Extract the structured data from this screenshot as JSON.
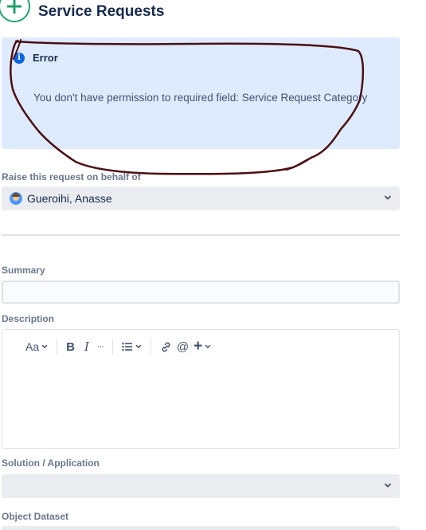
{
  "header": {
    "title": "Service Requests",
    "icon": "add-circle-icon"
  },
  "error": {
    "icon": "info-icon",
    "title": "Error",
    "message": "You don't have permission to required field: Service Request Category"
  },
  "on_behalf": {
    "label": "Raise this request on behalf of",
    "value": "Gueroihi, Anasse"
  },
  "summary": {
    "label": "Summary",
    "value": ""
  },
  "description": {
    "label": "Description",
    "toolbar": {
      "text_style": "Aa",
      "bold": "B",
      "italic": "I",
      "more": "···",
      "list": "☰",
      "link": "link-icon",
      "mention": "@",
      "insert": "+"
    }
  },
  "solution": {
    "label": "Solution / Application",
    "value": ""
  },
  "object_dataset": {
    "label": "Object Dataset"
  },
  "colors": {
    "accent": "#22a06b",
    "info_bg": "#deebff",
    "info_icon": "#0c66e4",
    "annotation": "#4a0f14"
  }
}
